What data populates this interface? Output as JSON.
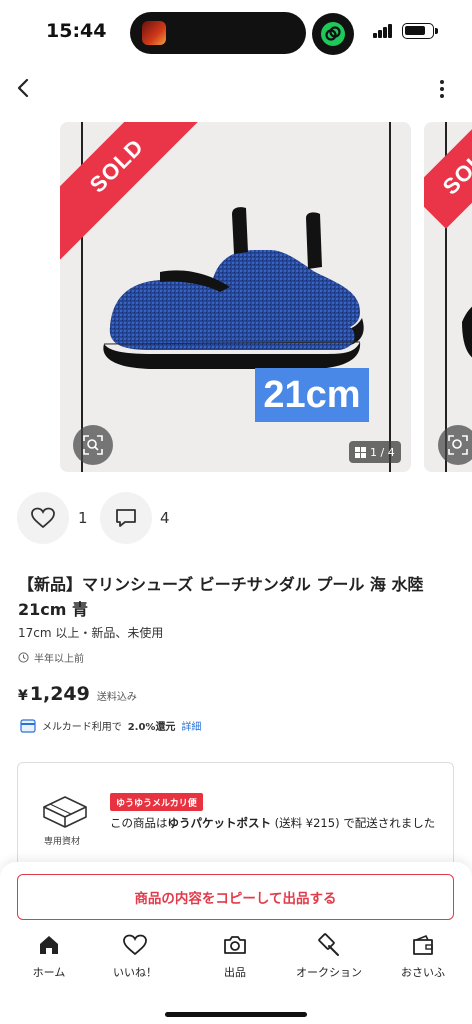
{
  "status_bar": {
    "time": "15:44"
  },
  "gallery": {
    "sold_label": "SOLD",
    "size_overlay": "21cm",
    "page_indicator": "1 / 4"
  },
  "social": {
    "like_count": "1",
    "comment_count": "4"
  },
  "item": {
    "title": "【新品】マリンシューズ ビーチサンダル プール 海 水陸 21cm 青",
    "condition": "17cm 以上・新品、未使用",
    "posted": "半年以上前",
    "price_currency": "¥",
    "price": "1,249",
    "shipping_included": "送料込み"
  },
  "card_promo": {
    "text": "メルカード利用で",
    "percent": "2.0%還元",
    "link": "詳細"
  },
  "shipping": {
    "package_label": "専用資材",
    "method_tag": "ゆうゆうメルカリ便",
    "desc_prefix": "この商品は",
    "desc_bold": "ゆうパケットポスト",
    "desc_suffix": " (送料 ¥215) で配送されました"
  },
  "bottom": {
    "copy_button": "商品の内容をコピーして出品する",
    "tabs": [
      {
        "label": "ホーム",
        "icon": "home-icon"
      },
      {
        "label": "いいね！",
        "icon": "heart-icon"
      },
      {
        "label": "出品",
        "icon": "camera-icon"
      },
      {
        "label": "オークション",
        "icon": "gavel-icon"
      },
      {
        "label": "おさいふ",
        "icon": "wallet-icon"
      }
    ]
  },
  "colors": {
    "accent": "#e23b4b",
    "sold": "#ea3548",
    "link": "#2a72d6",
    "size_chip": "#4a88e8"
  }
}
